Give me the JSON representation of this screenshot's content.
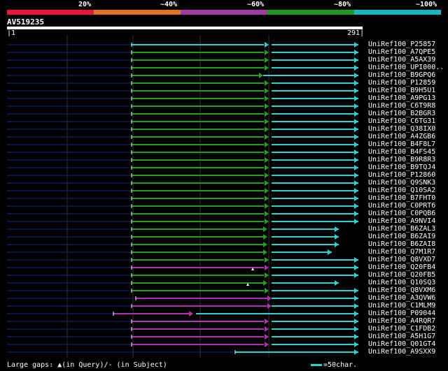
{
  "legend": {
    "labels": [
      "20%",
      "~40%",
      "~60%",
      "~80%",
      "~100%"
    ],
    "colors": [
      "#e8173a",
      "#e0741d",
      "#a23aa5",
      "#1c9a1c",
      "#19b6bd"
    ]
  },
  "query": {
    "name": "AV519235",
    "start": "1",
    "end": "291"
  },
  "colors": {
    "green": "#22a022",
    "cyan": "#2ad3d3",
    "magenta": "#b030b0",
    "navy": "#0d1a5c",
    "grid": "#333333"
  },
  "hits": [
    {
      "label": "UniRef100_P25857",
      "color": "cyan"
    },
    {
      "label": "UniRef100_A7QPE5",
      "color": "green"
    },
    {
      "label": "UniRef100_A5AX39",
      "color": "green"
    },
    {
      "label": "UniRef100_UPI000..",
      "color": "green"
    },
    {
      "label": "UniRef100_B9GPQ6",
      "color": "green"
    },
    {
      "label": "UniRef100_P12859",
      "color": "green"
    },
    {
      "label": "UniRef100_B9H5U1",
      "color": "green"
    },
    {
      "label": "UniRef100_A9PG13",
      "color": "green"
    },
    {
      "label": "UniRef100_C6T9R8",
      "color": "green"
    },
    {
      "label": "UniRef100_B2BGR3",
      "color": "green"
    },
    {
      "label": "UniRef100_C6TG31",
      "color": "green"
    },
    {
      "label": "UniRef100_Q38IX0",
      "color": "green"
    },
    {
      "label": "UniRef100_A4ZGB6",
      "color": "green"
    },
    {
      "label": "UniRef100_B4F8L7",
      "color": "green"
    },
    {
      "label": "UniRef100_B4FS45",
      "color": "green"
    },
    {
      "label": "UniRef100_B9R8R3",
      "color": "green"
    },
    {
      "label": "UniRef100_B9TQJ4",
      "color": "green"
    },
    {
      "label": "UniRef100_P12860",
      "color": "green"
    },
    {
      "label": "UniRef100_Q9SNK3",
      "color": "green"
    },
    {
      "label": "UniRef100_Q10SA2",
      "color": "green"
    },
    {
      "label": "UniRef100_B7FHT0",
      "color": "green"
    },
    {
      "label": "UniRef100_C0PRT6",
      "color": "green"
    },
    {
      "label": "UniRef100_C0PQB6",
      "color": "green"
    },
    {
      "label": "UniRef100_A9NVI4",
      "color": "green"
    },
    {
      "label": "UniRef100_B6ZAL3",
      "color": "green"
    },
    {
      "label": "UniRef100_B6ZAI9",
      "color": "green"
    },
    {
      "label": "UniRef100_B6ZAI8",
      "color": "green"
    },
    {
      "label": "UniRef100_Q7M1R7",
      "color": "green"
    },
    {
      "label": "UniRef100_Q8VXD7",
      "color": "green"
    },
    {
      "label": "UniRef100_Q20FB4",
      "color": "magenta"
    },
    {
      "label": "UniRef100_Q20FB5",
      "color": "green"
    },
    {
      "label": "UniRef100_Q10SQ3",
      "color": "green"
    },
    {
      "label": "UniRef100_Q8VXM6",
      "color": "green"
    },
    {
      "label": "UniRef100_A3QVW6",
      "color": "magenta"
    },
    {
      "label": "UniRef100_C1MLM9",
      "color": "magenta"
    },
    {
      "label": "UniRef100_P09044",
      "color": "magenta"
    },
    {
      "label": "UniRef100_A4RQR7",
      "color": "magenta"
    },
    {
      "label": "UniRef100_C1FDB2",
      "color": "magenta"
    },
    {
      "label": "UniRef100_A5H1G7",
      "color": "magenta"
    },
    {
      "label": "UniRef100_Q01GT4",
      "color": "magenta"
    },
    {
      "label": "UniRef100_A9SXX9",
      "color": "cyan"
    }
  ],
  "footer": {
    "gaps_text": "Large gaps: ▲(in Query)/- (in Subject)",
    "scale_text": "=50char."
  }
}
